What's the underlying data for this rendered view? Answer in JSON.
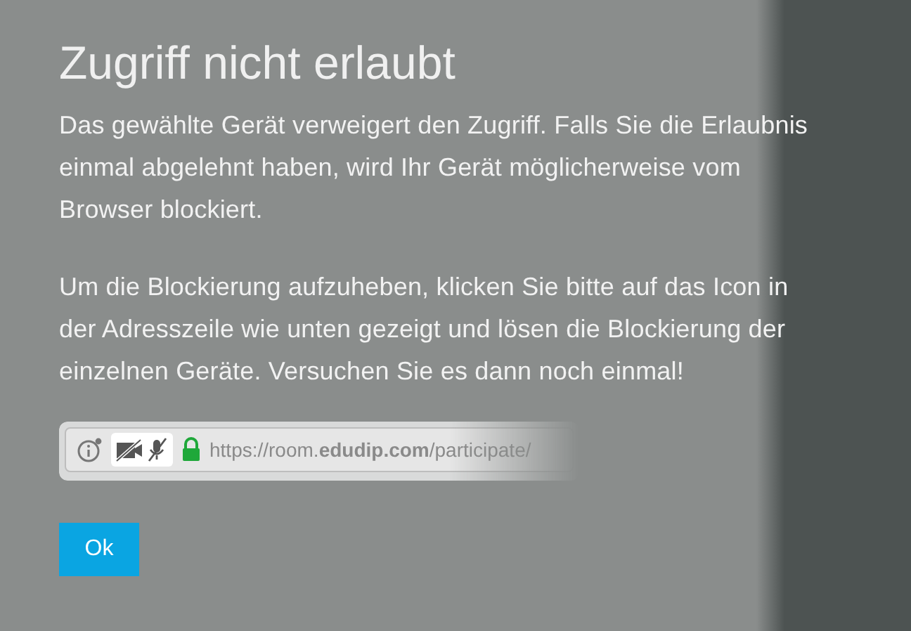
{
  "dialog": {
    "title": "Zugriff nicht erlaubt",
    "paragraphs": [
      "Das gewählte Gerät verweigert den Zugriff. Falls Sie die Erlaubnis einmal abgelehnt haben, wird Ihr Gerät möglicherweise vom Browser blockiert.",
      "Um die Blockierung aufzuheben, klicken Sie bitte auf das Icon in der Adresszeile wie unten gezeigt und lösen die Blockierung der einzelnen Geräte. Versuchen Sie es dann noch einmal!"
    ],
    "address_bar": {
      "url": "https://room.**edudip.com**/participate/"
    },
    "buttons": [
      "Ok"
    ]
  }
}
